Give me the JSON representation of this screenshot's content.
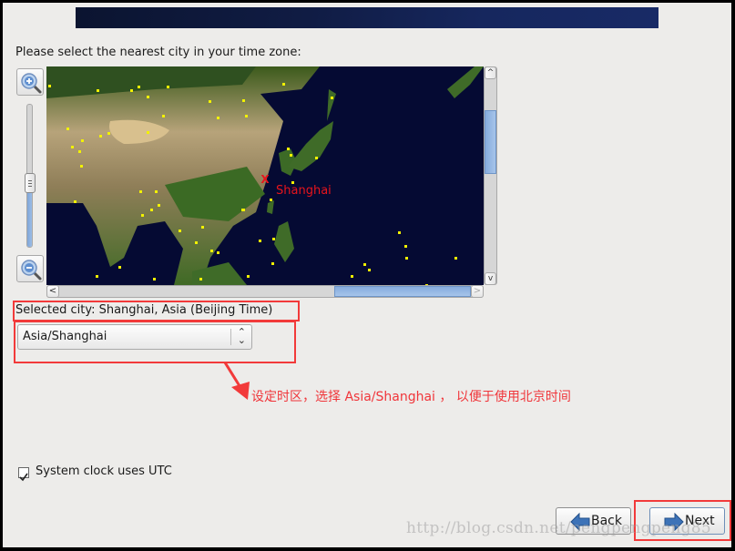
{
  "header": {
    "banner": "installer-banner"
  },
  "prompt": "Please select the nearest city in your time zone:",
  "map": {
    "zoom_in_icon": "zoom-in-icon",
    "zoom_out_icon": "zoom-out-icon",
    "zoom_level_fraction": 0.45,
    "selected_marker": {
      "symbol": "X",
      "label": "Shanghai",
      "color": "#e8141c"
    },
    "city_dot_color": "#f2f200",
    "vertical_scroll_fraction": 0.3,
    "horizontal_scroll_fraction": 0.78,
    "scroll_arrows": {
      "up": "^",
      "down": "v",
      "left": "<",
      "right": ">"
    }
  },
  "selected_city_label": "Selected city: Shanghai, Asia (Beijing Time)",
  "timezone_select": {
    "value": "Asia/Shanghai",
    "chevron": "⌃⌄"
  },
  "annotation": {
    "text": "设定时区，选择 Asia/Shanghai ， 以便于使用北京时间",
    "color": "#f0353a"
  },
  "utc_checkbox": {
    "label": "System clock uses UTC",
    "checked": true
  },
  "buttons": {
    "back": "Back",
    "next": "Next"
  },
  "watermark": "http://blog.csdn.net/pengpengpeng85"
}
